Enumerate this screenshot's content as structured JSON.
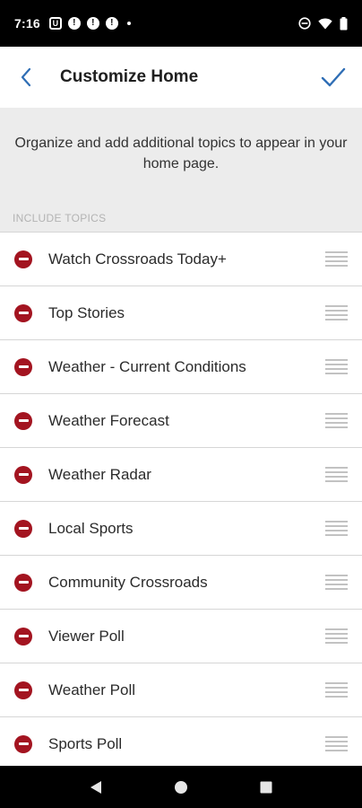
{
  "status_bar": {
    "time": "7:16",
    "u_badge": "U",
    "alert_symbol": "!",
    "icons": [
      "u-notification-icon",
      "alert-icon",
      "alert-icon",
      "alert-icon",
      "notification-dot",
      "do-not-disturb-icon",
      "wifi-icon",
      "battery-icon"
    ]
  },
  "app_bar": {
    "title": "Customize Home",
    "back_icon": "chevron-left-icon",
    "done_icon": "checkmark-icon",
    "accent_color": "#2f6eb5"
  },
  "description": "Organize and add additional topics to appear in your home page.",
  "section": {
    "header": "INCLUDE TOPICS"
  },
  "topics": [
    {
      "label": "Watch Crossroads Today+"
    },
    {
      "label": "Top Stories"
    },
    {
      "label": "Weather - Current Conditions"
    },
    {
      "label": "Weather Forecast"
    },
    {
      "label": "Weather Radar"
    },
    {
      "label": "Local Sports"
    },
    {
      "label": "Community Crossroads"
    },
    {
      "label": "Viewer Poll"
    },
    {
      "label": "Weather Poll"
    },
    {
      "label": "Sports Poll"
    }
  ],
  "colors": {
    "remove": "#a31420",
    "description_bg": "#ececec",
    "section_header": "#b3b3b3"
  },
  "nav_bar": {
    "icons": [
      "back-triangle-icon",
      "home-circle-icon",
      "recents-square-icon"
    ]
  }
}
